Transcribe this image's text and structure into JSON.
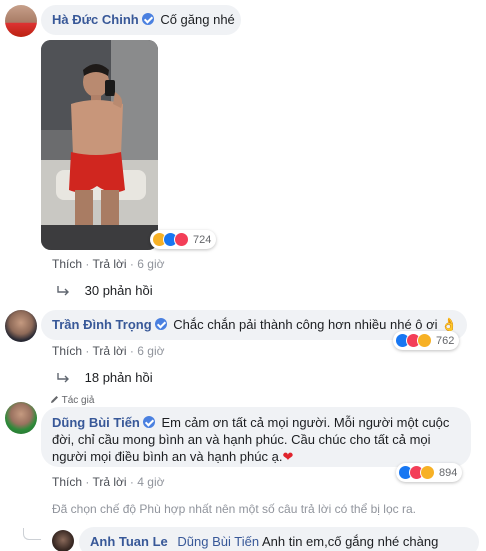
{
  "comment1": {
    "author": "Hà Đức Chinh",
    "text": "Cố găng nhé",
    "reactions_count": "724",
    "actions": {
      "like": "Thích",
      "reply": "Trả lời",
      "time": "6 giờ"
    },
    "replies_label": "30 phản hồi"
  },
  "comment2": {
    "author": "Trần Đình Trọng",
    "text": "Chắc chắn pải thành công hơn nhiều nhé ô ơi 👌",
    "reactions_count": "762",
    "actions": {
      "like": "Thích",
      "reply": "Trả lời",
      "time": "6 giờ"
    },
    "replies_label": "18 phản hồi"
  },
  "comment3": {
    "badge": "Tác giả",
    "author": "Dũng Bùi Tiến",
    "line1": "Em cảm ơn tất cả mọi người. Mỗi người một cuộc",
    "line2": "đời, chỉ cầu mong bình an và hạnh phúc. Cầu chúc cho tất cả mọi",
    "line3": "người mọi điều bình an và hạnh phúc ạ.",
    "heart": "❤",
    "reactions_count": "894",
    "actions": {
      "like": "Thích",
      "reply": "Trả lời",
      "time": "4 giờ"
    }
  },
  "filter_notice": "Đã chọn chế độ Phù hợp nhất nên một số câu trả lời có thể bị lọc ra.",
  "reply1": {
    "author": "Anh Tuan Le",
    "tag": "Dũng Bùi Tiến",
    "text": "Anh tin em,cố gắng nhé chàng"
  },
  "colors": {
    "name": "#385898",
    "bubble": "#f0f2f5",
    "meta": "#90949c",
    "verified": "#4a80e0"
  }
}
